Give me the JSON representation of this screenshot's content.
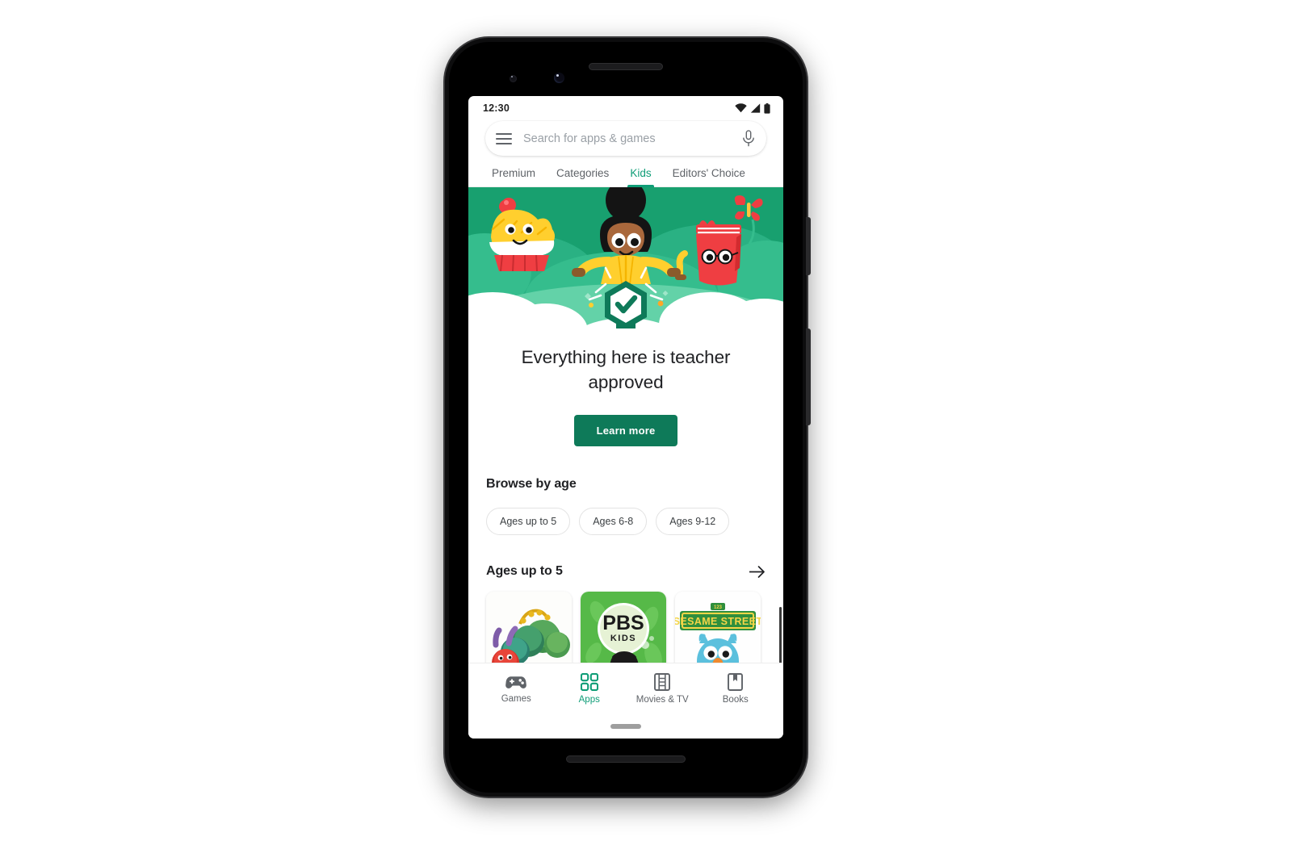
{
  "device": {
    "name": "Pixel 3 smartphone mockup",
    "frame_color": "#0d0d0e",
    "hardware": {
      "earpiece_speaker": "earpiece-speaker",
      "front_camera": "front-camera",
      "proximity_sensor": "proximity-sensor",
      "power_button": "power-button",
      "volume_button": "volume-button",
      "bottom_speaker": "bottom-speaker"
    }
  },
  "status_bar": {
    "time": "12:30",
    "icons": [
      "wifi-icon",
      "cellular-signal-icon",
      "battery-icon"
    ]
  },
  "search": {
    "value": "",
    "placeholder": "Search for apps & games",
    "menu_icon": "hamburger-menu-icon",
    "mic_icon": "microphone-icon"
  },
  "tabs": {
    "active": "Kids",
    "active_color": "#0f9d77",
    "items": [
      {
        "label": "Premium"
      },
      {
        "label": "Categories"
      },
      {
        "label": "Kids"
      },
      {
        "label": "Editors' Choice"
      }
    ]
  },
  "hero": {
    "illustration_alt": "Child on bicycle with teacher-approved badge, cupcake character, book character, butterfly, green hills and clouds",
    "background_color": "#18a06f",
    "title": "Everything here is teacher approved",
    "button_label": "Learn more",
    "button_color": "#0e7a59",
    "badge_icon": "teacher-approved-badge-icon"
  },
  "browse_by_age": {
    "title": "Browse by age",
    "chips": [
      {
        "label": "Ages up to 5"
      },
      {
        "label": "Ages 6-8"
      },
      {
        "label": "Ages 9-12"
      }
    ]
  },
  "ages_row": {
    "title": "Ages up to 5",
    "arrow_icon": "arrow-right-icon",
    "cards": [
      {
        "name": "The Very Hungry Caterpillar"
      },
      {
        "name": "PBS KIDS",
        "logo_text_top": "PBS",
        "logo_text_bottom": "KIDS"
      },
      {
        "name": "Sesame Street",
        "logo_text": "SESAME STREET"
      }
    ]
  },
  "bottom_nav": {
    "active": "Apps",
    "active_color": "#0f9d77",
    "items": [
      {
        "label": "Games",
        "icon": "gamepad-icon"
      },
      {
        "label": "Apps",
        "icon": "apps-grid-icon"
      },
      {
        "label": "Movies & TV",
        "icon": "film-strip-icon"
      },
      {
        "label": "Books",
        "icon": "book-bookmark-icon"
      }
    ]
  },
  "home_indicator": "home-indicator"
}
